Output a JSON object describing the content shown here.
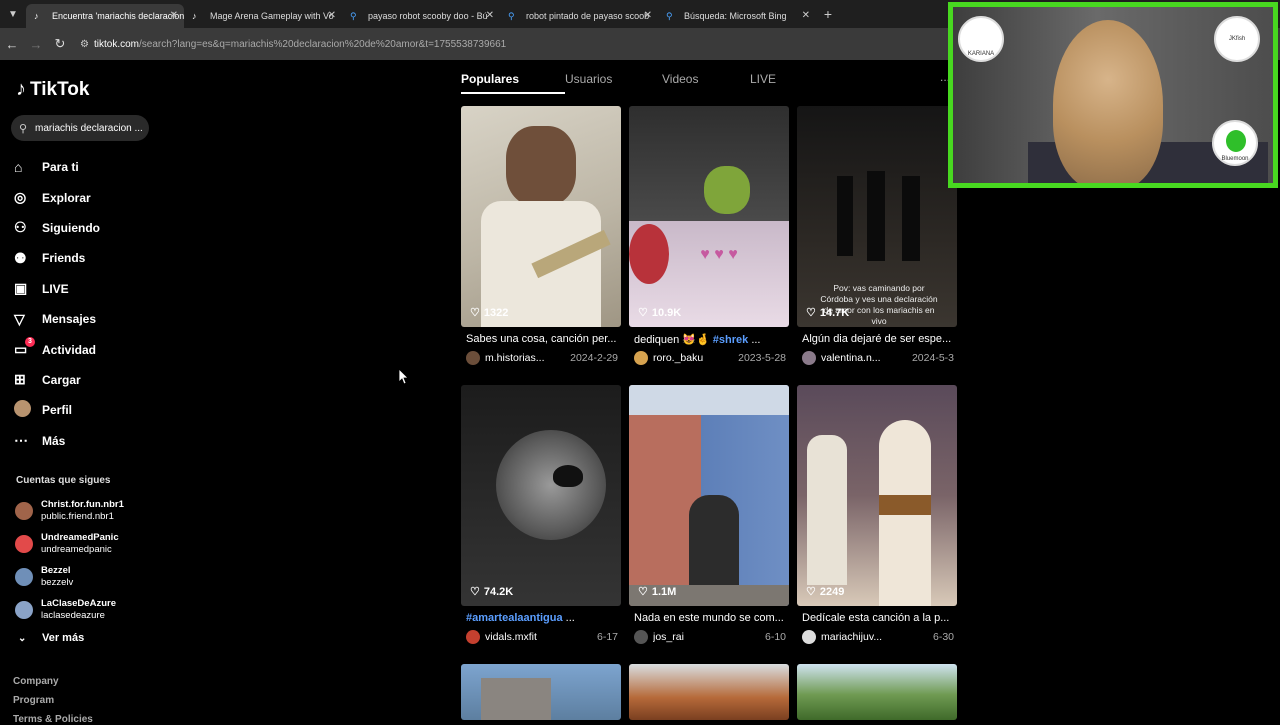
{
  "browser": {
    "tabs": [
      {
        "title": "Encuentra 'mariachis declaracion",
        "icon": "tiktok-icon",
        "active": true
      },
      {
        "title": "Mage Arena Gameplay with Vo",
        "icon": "tiktok-icon",
        "active": false
      },
      {
        "title": "payaso robot scooby doo - Bú",
        "icon": "search-icon",
        "active": false
      },
      {
        "title": "robot pintado de payaso scoob",
        "icon": "search-icon",
        "active": false
      },
      {
        "title": "Búsqueda: Microsoft Bing",
        "icon": "search-icon",
        "active": false
      }
    ],
    "url_host": "tiktok.com",
    "url_path": "/search?lang=es&q=mariachis%20declaracion%20de%20amor&t=1755538739661"
  },
  "app": {
    "logo": "TikTok",
    "search_value": "mariachis declaracion ..."
  },
  "nav": [
    {
      "label": "Para ti",
      "icon": "home-icon"
    },
    {
      "label": "Explorar",
      "icon": "compass-icon"
    },
    {
      "label": "Siguiendo",
      "icon": "following-icon"
    },
    {
      "label": "Friends",
      "icon": "friends-icon"
    },
    {
      "label": "LIVE",
      "icon": "live-icon"
    },
    {
      "label": "Mensajes",
      "icon": "messages-icon"
    },
    {
      "label": "Actividad",
      "icon": "activity-icon",
      "badge": "3"
    },
    {
      "label": "Cargar",
      "icon": "upload-icon"
    },
    {
      "label": "Perfil",
      "icon": "profile-avatar"
    },
    {
      "label": "Más",
      "icon": "more-icon"
    }
  ],
  "following": {
    "title": "Cuentas que sigues",
    "accounts": [
      {
        "name": "Christ.for.fun.nbr1",
        "handle": "public.friend.nbr1",
        "color": "#a0644a"
      },
      {
        "name": "UndreamedPanic",
        "handle": "undreamedpanic",
        "color": "#e24a4a"
      },
      {
        "name": "Bezzel",
        "handle": "bezzelv",
        "color": "#6f8fb8"
      },
      {
        "name": "LaClaseDeAzure",
        "handle": "laclasedeazure",
        "color": "#8aa3c8"
      }
    ],
    "more": "Ver más"
  },
  "footer": [
    "Company",
    "Program",
    "Terms & Policies"
  ],
  "result_tabs": [
    "Populares",
    "Usuarios",
    "Videos",
    "LIVE"
  ],
  "more_dots": "...",
  "videos": [
    {
      "likes": "1322",
      "caption": "Sabes una cosa, canción per...",
      "user": "m.historias...",
      "date": "2024-2-29",
      "avatar": "#6b4e3a",
      "thumb": "#c8c3b8"
    },
    {
      "likes": "10.9K",
      "caption_prefix": "dediquen 😻🤞",
      "caption_tag": "#shrek",
      "caption_suffix": " ...",
      "user": "roro._baku",
      "date": "2023-5-28",
      "avatar": "#d6a24f",
      "thumb": "#3a3a3a"
    },
    {
      "likes": "14.7K",
      "caption": "Algún dia dejaré de ser espe...",
      "user": "valentina.n...",
      "date": "2024-5-3",
      "avatar": "#8a7a8a",
      "thumb": "#222",
      "overlay": "Pov: vas caminando por Córdoba y ves una declaración de amor con los mariachis en vivo"
    },
    {
      "likes": "74.2K",
      "caption_tag": "#amartealaantigua",
      "caption_suffix": " ...",
      "user": "vidals.mxfit",
      "date": "6-17",
      "avatar": "#c4402f",
      "thumb": "#2b2b2b"
    },
    {
      "likes": "1.1M",
      "caption": "Nada en este mundo se com...",
      "user": "jos_rai",
      "date": "6-10",
      "avatar": "#555",
      "thumb": "#7d7770"
    },
    {
      "likes": "2249",
      "caption": "Dedícale esta canción a la p...",
      "user": "mariachijuv...",
      "date": "6-30",
      "avatar": "#ddd",
      "thumb": "#6e6060"
    },
    {
      "thumb": "#6d8fb0"
    },
    {
      "thumb": "#a76c3e"
    },
    {
      "thumb": "#6f9a52"
    }
  ],
  "cam": {
    "badge_left": "KARIANA",
    "badge_right_top": "JKfish",
    "badge_right_bottom": "Bluemoon"
  }
}
